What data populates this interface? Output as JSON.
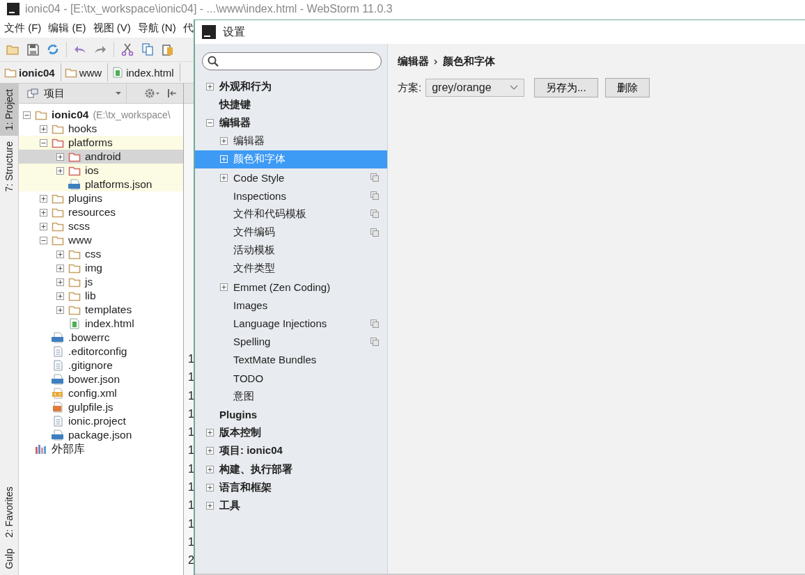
{
  "window": {
    "title": "ionic04 - [E:\\tx_workspace\\ionic04] - ...\\www\\index.html - WebStorm 11.0.3"
  },
  "menu": [
    "文件 (F)",
    "编辑 (E)",
    "视图 (V)",
    "导航 (N)",
    "代"
  ],
  "breadcrumb": [
    {
      "label": "ionic04",
      "kind": "folder",
      "bold": true
    },
    {
      "label": "www",
      "kind": "folder",
      "bold": false
    },
    {
      "label": "index.html",
      "kind": "html",
      "bold": false
    }
  ],
  "tool_windows_top": [
    {
      "label": "1: Project",
      "selected": true
    },
    {
      "label": "7: Structure",
      "selected": false
    }
  ],
  "tool_windows_bottom": [
    {
      "label": "2: Favorites",
      "selected": false
    },
    {
      "label": "Gulp",
      "selected": false
    }
  ],
  "project_panel": {
    "title": "项目",
    "tree": [
      {
        "label": "ionic04",
        "path": "(E:\\tx_workspace\\",
        "kind": "folder",
        "expandable": true,
        "expanded": true,
        "selected": false,
        "highlighted": false,
        "children": [
          {
            "label": "hooks",
            "kind": "folder",
            "expandable": true,
            "expanded": false,
            "selected": false,
            "highlighted": false
          },
          {
            "label": "platforms",
            "kind": "folder-excluded",
            "expandable": true,
            "expanded": true,
            "selected": false,
            "highlighted": true,
            "children": [
              {
                "label": "android",
                "kind": "folder-excluded",
                "expandable": true,
                "expanded": false,
                "selected": true,
                "highlighted": true
              },
              {
                "label": "ios",
                "kind": "folder-excluded",
                "expandable": true,
                "expanded": false,
                "selected": false,
                "highlighted": true
              },
              {
                "label": "platforms.json",
                "kind": "json",
                "expandable": false,
                "expanded": false,
                "selected": false,
                "highlighted": true
              }
            ]
          },
          {
            "label": "plugins",
            "kind": "folder",
            "expandable": true,
            "expanded": false,
            "selected": false,
            "highlighted": false
          },
          {
            "label": "resources",
            "kind": "folder",
            "expandable": true,
            "expanded": false,
            "selected": false,
            "highlighted": false
          },
          {
            "label": "scss",
            "kind": "folder",
            "expandable": true,
            "expanded": false,
            "selected": false,
            "highlighted": false
          },
          {
            "label": "www",
            "kind": "folder",
            "expandable": true,
            "expanded": true,
            "selected": false,
            "highlighted": false,
            "children": [
              {
                "label": "css",
                "kind": "folder",
                "expandable": true,
                "expanded": false,
                "selected": false,
                "highlighted": false
              },
              {
                "label": "img",
                "kind": "folder",
                "expandable": true,
                "expanded": false,
                "selected": false,
                "highlighted": false
              },
              {
                "label": "js",
                "kind": "folder",
                "expandable": true,
                "expanded": false,
                "selected": false,
                "highlighted": false
              },
              {
                "label": "lib",
                "kind": "folder",
                "expandable": true,
                "expanded": false,
                "selected": false,
                "highlighted": false
              },
              {
                "label": "templates",
                "kind": "folder",
                "expandable": true,
                "expanded": false,
                "selected": false,
                "highlighted": false
              },
              {
                "label": "index.html",
                "kind": "html",
                "expandable": false,
                "expanded": false,
                "selected": false,
                "highlighted": false
              }
            ]
          },
          {
            "label": ".bowerrc",
            "kind": "json",
            "expandable": false,
            "expanded": false,
            "selected": false,
            "highlighted": false
          },
          {
            "label": ".editorconfig",
            "kind": "text",
            "expandable": false,
            "expanded": false,
            "selected": false,
            "highlighted": false
          },
          {
            "label": ".gitignore",
            "kind": "text",
            "expandable": false,
            "expanded": false,
            "selected": false,
            "highlighted": false
          },
          {
            "label": "bower.json",
            "kind": "json",
            "expandable": false,
            "expanded": false,
            "selected": false,
            "highlighted": false
          },
          {
            "label": "config.xml",
            "kind": "xml",
            "expandable": false,
            "expanded": false,
            "selected": false,
            "highlighted": false
          },
          {
            "label": "gulpfile.js",
            "kind": "js",
            "expandable": false,
            "expanded": false,
            "selected": false,
            "highlighted": false
          },
          {
            "label": "ionic.project",
            "kind": "text",
            "expandable": false,
            "expanded": false,
            "selected": false,
            "highlighted": false
          },
          {
            "label": "package.json",
            "kind": "json",
            "expandable": false,
            "expanded": false,
            "selected": false,
            "highlighted": false
          }
        ]
      },
      {
        "label": "外部库",
        "kind": "library",
        "expandable": false,
        "expanded": false,
        "selected": false,
        "highlighted": false
      }
    ]
  },
  "editor": {
    "line_numbers": [
      "1",
      "1",
      "1",
      "1",
      "1",
      "1",
      "1",
      "1",
      "1",
      "1",
      "1",
      "2"
    ]
  },
  "settings": {
    "title": "设置",
    "tree": [
      {
        "label": "外观和行为",
        "expandable": true,
        "expanded": false,
        "selected": false,
        "per_project": false
      },
      {
        "label": "快捷键",
        "expandable": false,
        "expanded": false,
        "selected": false,
        "per_project": false
      },
      {
        "label": "编辑器",
        "expandable": true,
        "expanded": true,
        "selected": false,
        "per_project": false,
        "children": [
          {
            "label": "编辑器",
            "expandable": true,
            "expanded": false,
            "selected": false,
            "per_project": false
          },
          {
            "label": "颜色和字体",
            "expandable": true,
            "expanded": false,
            "selected": true,
            "per_project": false
          },
          {
            "label": "Code Style",
            "expandable": true,
            "expanded": false,
            "selected": false,
            "per_project": true
          },
          {
            "label": "Inspections",
            "expandable": false,
            "expanded": false,
            "selected": false,
            "per_project": true
          },
          {
            "label": "文件和代码模板",
            "expandable": false,
            "expanded": false,
            "selected": false,
            "per_project": true
          },
          {
            "label": "文件编码",
            "expandable": false,
            "expanded": false,
            "selected": false,
            "per_project": true
          },
          {
            "label": "活动模板",
            "expandable": false,
            "expanded": false,
            "selected": false,
            "per_project": false
          },
          {
            "label": "文件类型",
            "expandable": false,
            "expanded": false,
            "selected": false,
            "per_project": false
          },
          {
            "label": "Emmet (Zen Coding)",
            "expandable": true,
            "expanded": false,
            "selected": false,
            "per_project": false
          },
          {
            "label": "Images",
            "expandable": false,
            "expanded": false,
            "selected": false,
            "per_project": false
          },
          {
            "label": "Language Injections",
            "expandable": false,
            "expanded": false,
            "selected": false,
            "per_project": true
          },
          {
            "label": "Spelling",
            "expandable": false,
            "expanded": false,
            "selected": false,
            "per_project": true
          },
          {
            "label": "TextMate Bundles",
            "expandable": false,
            "expanded": false,
            "selected": false,
            "per_project": false
          },
          {
            "label": "TODO",
            "expandable": false,
            "expanded": false,
            "selected": false,
            "per_project": false
          },
          {
            "label": "意图",
            "expandable": false,
            "expanded": false,
            "selected": false,
            "per_project": false
          }
        ]
      },
      {
        "label": "Plugins",
        "expandable": false,
        "expanded": false,
        "selected": false,
        "per_project": false
      },
      {
        "label": "版本控制",
        "expandable": true,
        "expanded": false,
        "selected": false,
        "per_project": false
      },
      {
        "label": "项目: ionic04",
        "expandable": true,
        "expanded": false,
        "selected": false,
        "per_project": false
      },
      {
        "label": "构建、执行部署",
        "expandable": true,
        "expanded": false,
        "selected": false,
        "per_project": false
      },
      {
        "label": "语言和框架",
        "expandable": true,
        "expanded": false,
        "selected": false,
        "per_project": false
      },
      {
        "label": "工具",
        "expandable": true,
        "expanded": false,
        "selected": false,
        "per_project": false
      }
    ],
    "breadcrumb": [
      "编辑器",
      "颜色和字体"
    ],
    "scheme": {
      "label": "方案:",
      "value": "grey/orange"
    },
    "buttons": [
      "另存为...",
      "删除"
    ]
  }
}
